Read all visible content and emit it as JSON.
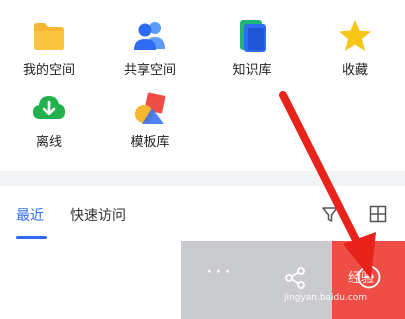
{
  "grid": {
    "items": [
      {
        "label": "我的空间",
        "icon": "folder-icon",
        "color": "#f7b731"
      },
      {
        "label": "共享空间",
        "icon": "shared-users-icon",
        "color": "#2f6bf2"
      },
      {
        "label": "知识库",
        "icon": "knowledge-base-icon",
        "color": "#21b57a"
      },
      {
        "label": "收藏",
        "icon": "star-icon",
        "color": "#f5c518"
      },
      {
        "label": "离线",
        "icon": "cloud-download-icon",
        "color": "#22b14c"
      },
      {
        "label": "模板库",
        "icon": "template-shapes-icon",
        "color": "#ef4e46"
      }
    ]
  },
  "tabs": {
    "recent": "最近",
    "quick_access": "快速访问",
    "filter_icon": "filter-icon",
    "grid_view_icon": "grid-view-icon",
    "active_color": "#2f6bf2"
  },
  "action_bar": {
    "more_label": "···",
    "share_icon": "share-icon",
    "circle_icon": "circle-more-icon",
    "highlight_color": "#ef4e46"
  },
  "watermark": {
    "text": "jingyan.baidu.com",
    "logo_text": "经验"
  },
  "annotation": {
    "arrow_color": "#e8231c"
  }
}
